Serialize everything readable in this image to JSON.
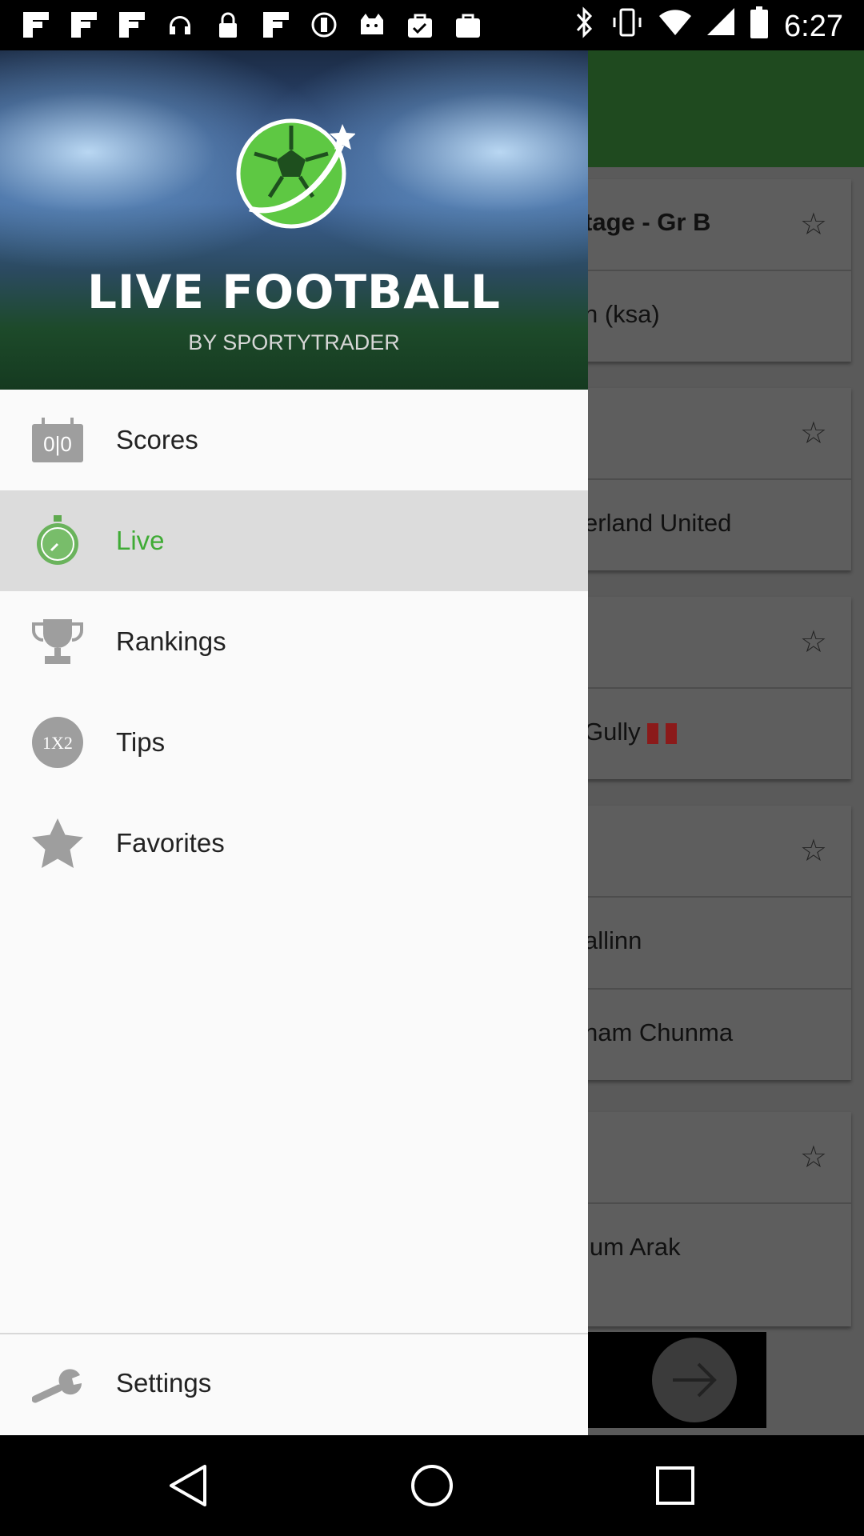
{
  "status_bar": {
    "time": "6:27",
    "notification_icons": [
      "flipboard-icon",
      "flipboard-icon",
      "flipboard-icon",
      "headset-icon",
      "lock-icon",
      "flipboard-icon",
      "circle-icon",
      "cat-icon",
      "bag-check-icon",
      "bag-icon"
    ],
    "system_icons": [
      "bluetooth-icon",
      "vibrate-icon",
      "wifi-icon",
      "signal-icon",
      "battery-icon"
    ]
  },
  "drawer": {
    "title": "LIVE FOOTBALL",
    "subtitle": "BY SPORTYTRADER",
    "menu": [
      {
        "label": "Scores",
        "icon": "scoreboard-icon",
        "active": false
      },
      {
        "label": "Live",
        "icon": "stopwatch-icon",
        "active": true
      },
      {
        "label": "Rankings",
        "icon": "trophy-icon",
        "active": false
      },
      {
        "label": "Tips",
        "icon": "1x2-icon",
        "active": false
      },
      {
        "label": "Favorites",
        "icon": "star-icon",
        "active": false
      }
    ],
    "settings": {
      "label": "Settings",
      "icon": "wrench-icon"
    },
    "tips_icon_text": "1X2",
    "scores_icon_text": "0|0"
  },
  "background": {
    "rows": [
      "tage - Gr B",
      "h (ksa)",
      "erland United",
      "Gully",
      "allinn",
      "nam Chunma",
      "ium Arak"
    ]
  },
  "colors": {
    "accent": "#3fab35",
    "active_bg": "#dcdcdc",
    "drawer_bg": "#fafafa",
    "header_green": "#1f4a1f"
  }
}
